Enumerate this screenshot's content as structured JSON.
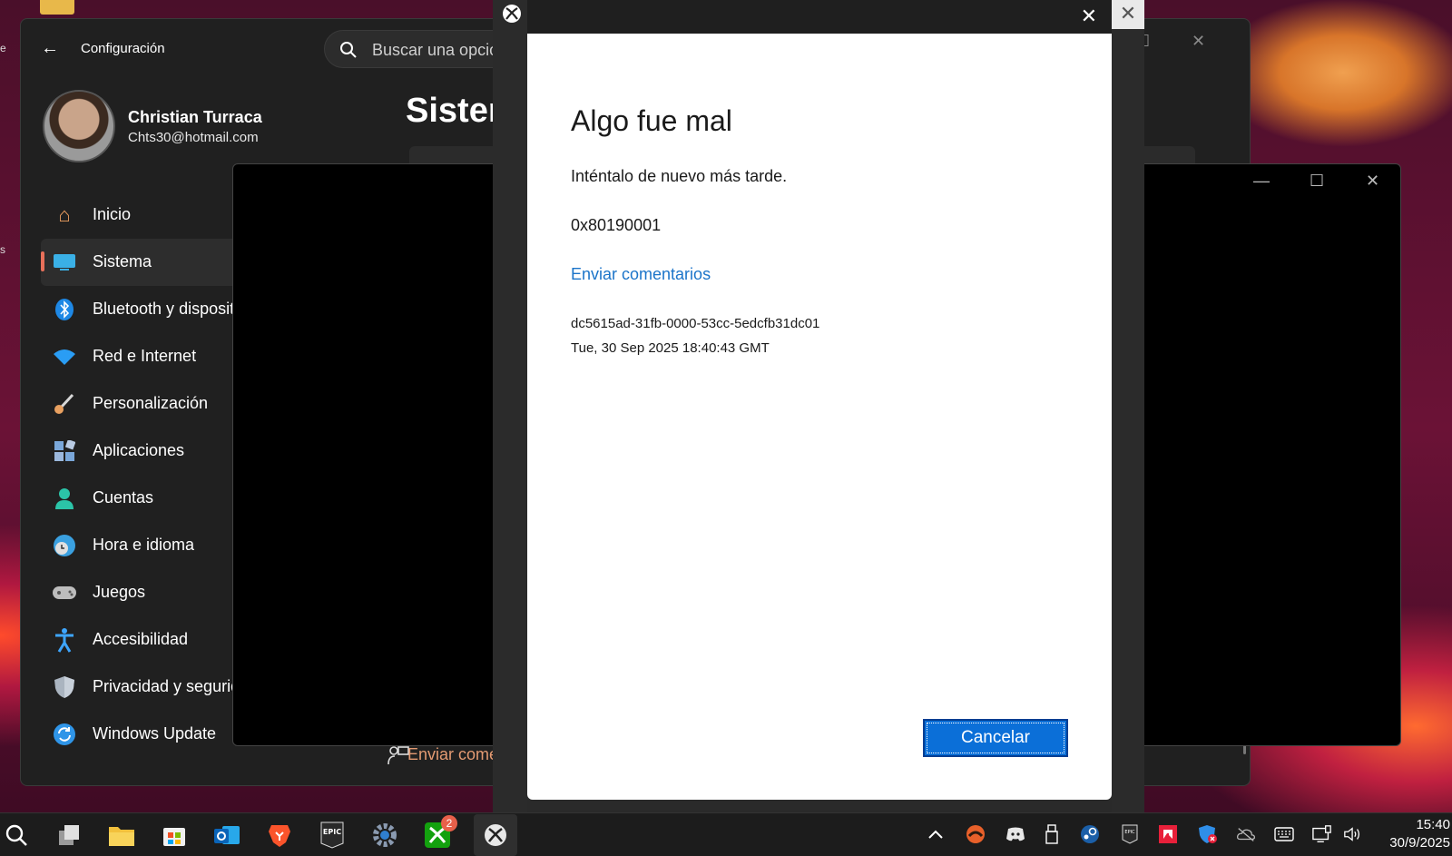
{
  "settings": {
    "app_title": "Configuración",
    "back_glyph": "←",
    "search_placeholder": "Buscar una opción",
    "user_name": "Christian Turraca",
    "user_email": "Chts30@hotmail.com",
    "page_heading": "Sistema",
    "nav": [
      {
        "label": "Inicio",
        "icon": "home-icon",
        "glyph": "⌂",
        "color": "#f0a060"
      },
      {
        "label": "Sistema",
        "icon": "monitor-icon",
        "glyph": "▬",
        "color": "#3ab0e6",
        "active": true
      },
      {
        "label": "Bluetooth y dispositivos",
        "icon": "bluetooth-icon",
        "glyph": "ʙ",
        "color": "#1e88e5"
      },
      {
        "label": "Red e Internet",
        "icon": "wifi-icon",
        "glyph": "◠",
        "color": "#2a9df4"
      },
      {
        "label": "Personalización",
        "icon": "brush-icon",
        "glyph": "✎",
        "color": "#e8a060"
      },
      {
        "label": "Aplicaciones",
        "icon": "apps-icon",
        "glyph": "▦",
        "color": "#7aa7d9"
      },
      {
        "label": "Cuentas",
        "icon": "person-icon",
        "glyph": "●",
        "color": "#2bc4a8"
      },
      {
        "label": "Hora e idioma",
        "icon": "globe-clock-icon",
        "glyph": "◍",
        "color": "#3aa0e0"
      },
      {
        "label": "Juegos",
        "icon": "gamepad-icon",
        "glyph": "◉",
        "color": "#bdbdbd"
      },
      {
        "label": "Accesibilidad",
        "icon": "accessibility-icon",
        "glyph": "✦",
        "color": "#3ea6ff"
      },
      {
        "label": "Privacidad y seguridad",
        "icon": "shield-icon",
        "glyph": "◆",
        "color": "#aab4c0"
      },
      {
        "label": "Windows Update",
        "icon": "update-icon",
        "glyph": "⟳",
        "color": "#2f95e8"
      }
    ],
    "feedback_label": "Enviar comentarios"
  },
  "dialog": {
    "title": "Algo fue mal",
    "message": "Inténtalo de nuevo más tarde.",
    "error_code": "0x80190001",
    "feedback_link": "Enviar comentarios",
    "correlation_id": "dc5615ad-31fb-0000-53cc-5edcfb31dc01",
    "timestamp": "Tue, 30 Sep 2025 18:40:43 GMT",
    "cancel_label": "Cancelar"
  },
  "window_controls": {
    "close": "✕",
    "minimize": "—",
    "maximize": "☐"
  },
  "taskbar": {
    "apps": [
      {
        "name": "search-icon",
        "glyph": "⌕"
      },
      {
        "name": "task-view-icon",
        "glyph": "❐"
      },
      {
        "name": "file-explorer-icon",
        "glyph": "▰"
      },
      {
        "name": "microsoft-store-icon",
        "glyph": "▦"
      },
      {
        "name": "outlook-icon",
        "glyph": "✉"
      },
      {
        "name": "brave-icon",
        "glyph": "🛡"
      },
      {
        "name": "epic-games-icon",
        "glyph": "EPIC"
      },
      {
        "name": "settings-gear-icon",
        "glyph": "⚙"
      },
      {
        "name": "xbox-icon",
        "glyph": "X",
        "badge": "2"
      },
      {
        "name": "xbox-active-icon",
        "glyph": "ⓧ"
      }
    ],
    "tray": [
      {
        "name": "chevron-up-icon",
        "glyph": "^"
      },
      {
        "name": "game-tray-icon",
        "glyph": "●"
      },
      {
        "name": "discord-icon",
        "glyph": "◙"
      },
      {
        "name": "usb-icon",
        "glyph": "▯"
      },
      {
        "name": "steam-icon",
        "glyph": "◎"
      },
      {
        "name": "epic-tray-icon",
        "glyph": "E"
      },
      {
        "name": "amd-icon",
        "glyph": "◪"
      },
      {
        "name": "defender-icon",
        "glyph": "◈"
      },
      {
        "name": "onedrive-icon",
        "glyph": "☁"
      },
      {
        "name": "keyboard-icon",
        "glyph": "⌨"
      },
      {
        "name": "network-icon",
        "glyph": "▭"
      },
      {
        "name": "volume-icon",
        "glyph": "🔊"
      }
    ],
    "clock_time": "15:40",
    "clock_date": "30/9/2025"
  }
}
